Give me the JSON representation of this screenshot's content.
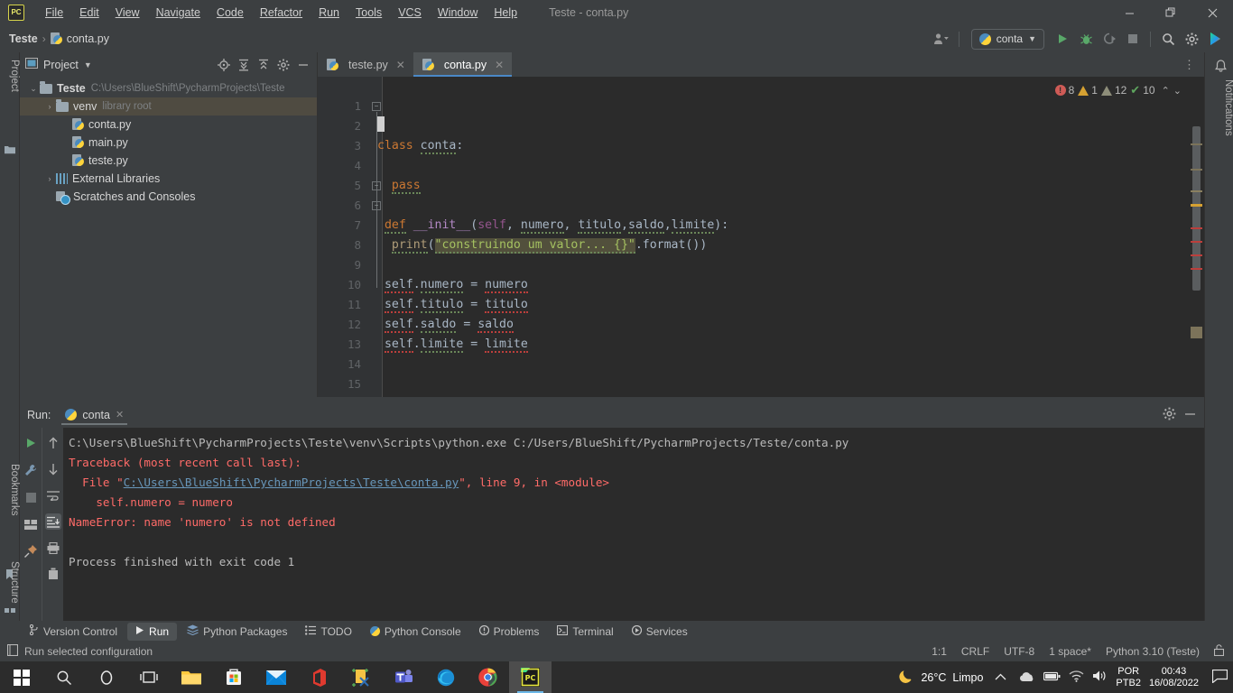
{
  "window": {
    "title": "Teste - conta.py",
    "app_icon": "PC",
    "controls": {
      "minimize": "—",
      "maximize": "❐",
      "close": "✕"
    }
  },
  "menu": [
    {
      "label": "File"
    },
    {
      "label": "Edit"
    },
    {
      "label": "View"
    },
    {
      "label": "Navigate"
    },
    {
      "label": "Code"
    },
    {
      "label": "Refactor"
    },
    {
      "label": "Run"
    },
    {
      "label": "Tools"
    },
    {
      "label": "VCS"
    },
    {
      "label": "Window"
    },
    {
      "label": "Help"
    }
  ],
  "navbar": {
    "crumbs": [
      "Teste",
      "conta.py"
    ],
    "separator": "›",
    "run_config": "conta",
    "icons": [
      "user-icon",
      "run-icon",
      "debug-icon",
      "coverage-icon",
      "stop-icon",
      "search-icon",
      "settings-icon",
      "updates-icon"
    ]
  },
  "left_strips": {
    "project": "Project",
    "bookmarks": "Bookmarks",
    "structure": "Structure"
  },
  "right_strip": {
    "notifications": "Notifications"
  },
  "project_pane": {
    "title": "Project",
    "header_icons": [
      "locate-icon",
      "expand-all-icon",
      "collapse-all-icon",
      "settings-icon",
      "hide-icon"
    ],
    "tree": [
      {
        "indent": 0,
        "arrow": "⌄",
        "icon": "folder",
        "label": "Teste",
        "bold": true,
        "dim": "C:\\Users\\BlueShift\\PycharmProjects\\Teste",
        "selected": false
      },
      {
        "indent": 1,
        "arrow": "›",
        "icon": "folder",
        "label": "venv",
        "bold": false,
        "dim": "library root",
        "selected": true
      },
      {
        "indent": 2,
        "arrow": "",
        "icon": "python",
        "label": "conta.py",
        "bold": false,
        "dim": "",
        "selected": false
      },
      {
        "indent": 2,
        "arrow": "",
        "icon": "python",
        "label": "main.py",
        "bold": false,
        "dim": "",
        "selected": false
      },
      {
        "indent": 2,
        "arrow": "",
        "icon": "python",
        "label": "teste.py",
        "bold": false,
        "dim": "",
        "selected": false
      },
      {
        "indent": 0,
        "arrow": "›",
        "icon": "library",
        "label": "External Libraries",
        "bold": false,
        "dim": "",
        "selected": false
      },
      {
        "indent": 1,
        "arrow": "",
        "icon": "scratch",
        "label": "Scratches and Consoles",
        "bold": false,
        "dim": "",
        "selected": false
      }
    ]
  },
  "editor": {
    "tabs": [
      {
        "label": "teste.py",
        "active": false,
        "close": "✕"
      },
      {
        "label": "conta.py",
        "active": true,
        "close": "✕"
      }
    ],
    "inspection": {
      "errors": "8",
      "warnings": "1",
      "weak_warnings": "12",
      "passed": "10",
      "up": "⌃",
      "down": "⌄"
    },
    "lines": [
      {
        "n": "1",
        "text": ""
      },
      {
        "n": "2",
        "text": "class conta:"
      },
      {
        "n": "3",
        "text": ""
      },
      {
        "n": "4",
        "text": "    pass"
      },
      {
        "n": "5",
        "text": ""
      },
      {
        "n": "6",
        "text": "    def __init__(self, numero, titulo,saldo,limite):"
      },
      {
        "n": "7",
        "text": "        print(\"construindo um valor... {}\".format())"
      },
      {
        "n": "8",
        "text": ""
      },
      {
        "n": "9",
        "text": "    self.numero = numero"
      },
      {
        "n": "10",
        "text": "    self.titulo = titulo"
      },
      {
        "n": "11",
        "text": "    self.saldo = saldo"
      },
      {
        "n": "12",
        "text": "    self.limite = limite"
      },
      {
        "n": "13",
        "text": ""
      },
      {
        "n": "14",
        "text": ""
      },
      {
        "n": "15",
        "text": ""
      }
    ]
  },
  "run_pane": {
    "label": "Run:",
    "tab": "conta",
    "tab_close": "✕",
    "header_icons": [
      "settings-icon",
      "hide-icon"
    ],
    "left_buttons": [
      "rerun-icon",
      "wrench-icon",
      "stop-icon",
      "layout-icon",
      "pin-icon"
    ],
    "right_buttons": [
      "up-icon",
      "down-icon",
      "soft-wrap-icon",
      "scroll-end-icon",
      "print-icon",
      "clear-icon"
    ],
    "console": [
      {
        "type": "plain",
        "text": "C:\\Users\\BlueShift\\PycharmProjects\\Teste\\venv\\Scripts\\python.exe C:/Users/BlueShift/PycharmProjects/Teste/conta.py"
      },
      {
        "type": "error",
        "text": "Traceback (most recent call last):"
      },
      {
        "type": "link-line",
        "prefix": "  File \"",
        "link": "C:\\Users\\BlueShift\\PycharmProjects\\Teste\\conta.py",
        "suffix": "\", line 9, in <module>"
      },
      {
        "type": "error",
        "text": "    self.numero = numero"
      },
      {
        "type": "error",
        "text": "NameError: name 'numero' is not defined"
      },
      {
        "type": "plain",
        "text": ""
      },
      {
        "type": "plain",
        "text": "Process finished with exit code 1"
      }
    ]
  },
  "bottom_toolwindows": [
    {
      "label": "Version Control",
      "icon": "branch-icon",
      "active": false
    },
    {
      "label": "Run",
      "icon": "play-icon",
      "active": true
    },
    {
      "label": "Python Packages",
      "icon": "packages-icon",
      "active": false
    },
    {
      "label": "TODO",
      "icon": "todo-icon",
      "active": false
    },
    {
      "label": "Python Console",
      "icon": "python-icon",
      "active": false
    },
    {
      "label": "Problems",
      "icon": "problems-icon",
      "active": false
    },
    {
      "label": "Terminal",
      "icon": "terminal-icon",
      "active": false
    },
    {
      "label": "Services",
      "icon": "services-icon",
      "active": false
    }
  ],
  "statusbar": {
    "message": "Run selected configuration",
    "message_icon": "config-icon",
    "caret": "1:1",
    "line_separator": "CRLF",
    "encoding": "UTF-8",
    "indent": "1 space*",
    "interpreter": "Python 3.10 (Teste)",
    "lock_icon": "lock-icon"
  },
  "taskbar": {
    "icons": [
      "windows-start-icon",
      "search-icon",
      "cortana-icon",
      "task-view-icon",
      "file-explorer-icon",
      "microsoft-store-icon",
      "mail-icon",
      "office-icon",
      "sticky-notes-icon",
      "microsoft-teams-icon",
      "microsoft-edge-icon",
      "google-chrome-icon",
      "pycharm-icon"
    ],
    "focused_icon": "pycharm-icon",
    "weather": {
      "icon": "moon-icon",
      "temperature": "26°C",
      "condition": "Limpo"
    },
    "tray_icons": [
      "chevron-up-icon",
      "onedrive-icon",
      "battery-icon",
      "wifi-icon",
      "volume-icon"
    ],
    "language": {
      "line1": "POR",
      "line2": "PTB2"
    },
    "clock": {
      "time": "00:43",
      "date": "16/08/2022"
    },
    "action_center_icon": "notification-icon"
  },
  "colors": {
    "accent_blue": "#4a88c7",
    "editor_bg": "#2b2b2b",
    "panel_bg": "#3c3f41",
    "keyword_orange": "#cc7832",
    "string_green": "#a5c261",
    "func_yellow": "#ffc66d",
    "error_red": "#ff6b68",
    "link_blue": "#6897bb",
    "selection": "#4f4b41"
  }
}
